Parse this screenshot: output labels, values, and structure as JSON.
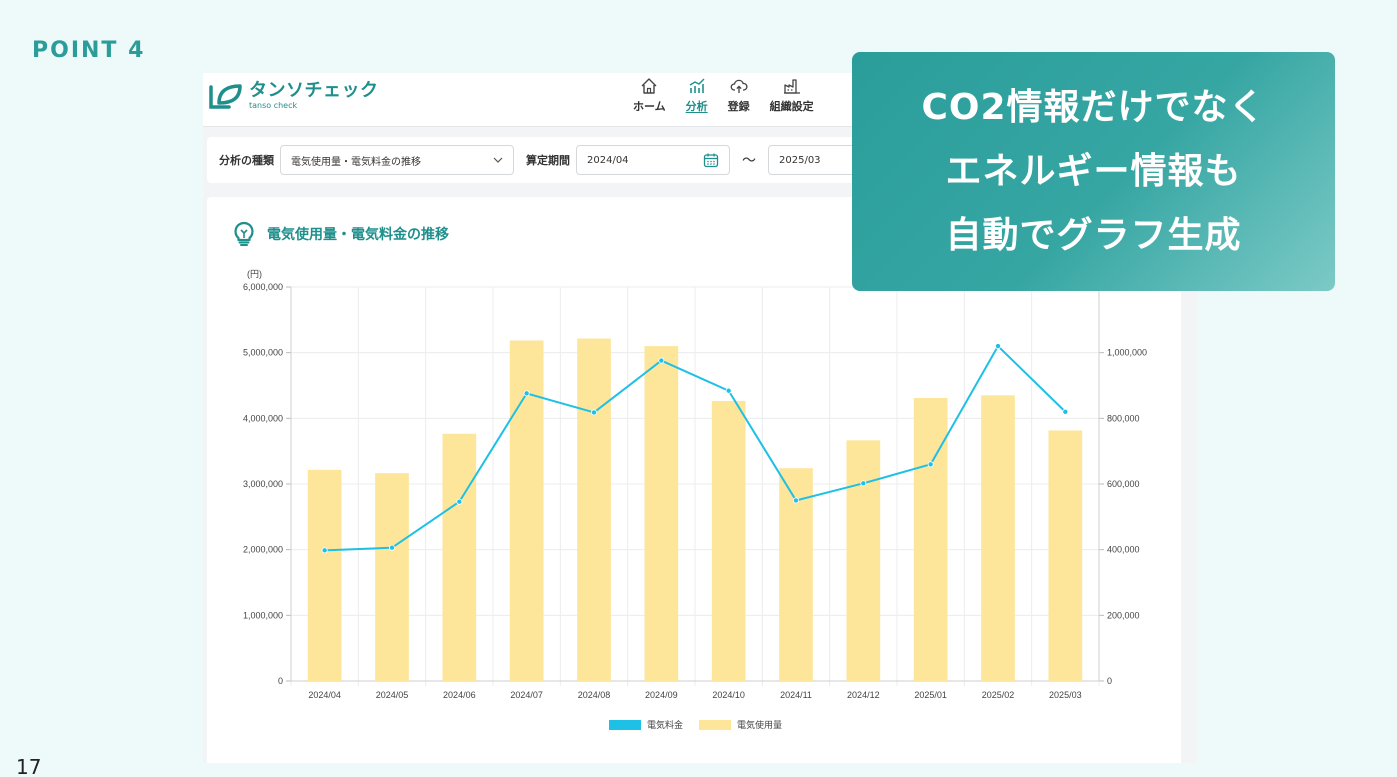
{
  "point_label": "POINT 4",
  "page_number": "17",
  "callout": {
    "line1": "CO2情報だけでなく",
    "line2": "エネルギー情報も",
    "line3": "自動でグラフ生成"
  },
  "app": {
    "logo_name": "タンソチェック",
    "logo_sub": "tanso check",
    "nav": [
      {
        "label": "ホーム",
        "icon": "home-icon",
        "active": false
      },
      {
        "label": "分析",
        "icon": "analytics-icon",
        "active": true
      },
      {
        "label": "登録",
        "icon": "cloud-upload-icon",
        "active": false
      },
      {
        "label": "組織設定",
        "icon": "factory-icon",
        "active": false
      }
    ],
    "filter": {
      "type_label": "分析の種類",
      "type_value": "電気使用量・電気料金の推移",
      "period_label": "算定期間",
      "start": "2024/04",
      "separator": "〜",
      "end": "2025/03"
    },
    "chart_title": "電気使用量・電気料金の推移"
  },
  "colors": {
    "accent": "#1f8f8c",
    "bar": "#fde59a",
    "line": "#1ec0e6"
  },
  "chart_data": {
    "type": "bar",
    "title": "電気使用量・電気料金の推移",
    "categories": [
      "2024/04",
      "2024/05",
      "2024/06",
      "2024/07",
      "2024/08",
      "2024/09",
      "2024/10",
      "2024/11",
      "2024/12",
      "2025/01",
      "2025/02",
      "2025/03"
    ],
    "series": [
      {
        "name": "電気使用量",
        "type": "bar",
        "axis": "right",
        "color": "#fde59a",
        "values": [
          643000,
          633000,
          753000,
          1037000,
          1043000,
          1020000,
          853000,
          648000,
          733000,
          862000,
          870000,
          763000
        ]
      },
      {
        "name": "電気料金",
        "type": "line",
        "axis": "left",
        "color": "#1ec0e6",
        "values": [
          1990000,
          2030000,
          2730000,
          4380000,
          4090000,
          4880000,
          4420000,
          2750000,
          3010000,
          3300000,
          5100000,
          4100000
        ]
      }
    ],
    "y_left": {
      "unit": "(円)",
      "ylim": [
        0,
        6000000
      ],
      "ticks": [
        "0",
        "1,000,000",
        "2,000,000",
        "3,000,000",
        "4,000,000",
        "5,000,000",
        "6,000,000"
      ]
    },
    "y_right": {
      "ylim": [
        0,
        1200000
      ],
      "ticks": [
        "0",
        "200,000",
        "400,000",
        "600,000",
        "800,000",
        "1,000,000"
      ]
    },
    "legend": [
      "電気料金",
      "電気使用量"
    ],
    "legend_position": "bottom",
    "grid": true
  }
}
